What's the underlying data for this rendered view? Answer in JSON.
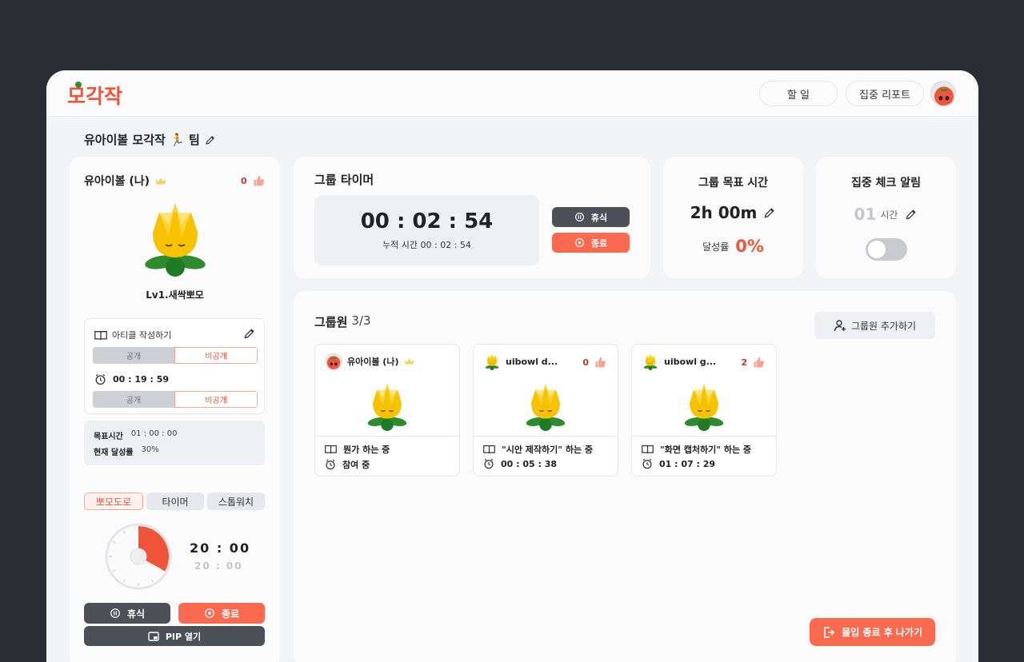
{
  "app": {
    "logo_text": "모각작"
  },
  "header": {
    "todo_label": "할 일",
    "report_label": "집중 리포트"
  },
  "team": {
    "title": "유아이볼 모각작 🏃 팀"
  },
  "profile": {
    "name": "유아이볼 (나)",
    "likes": "0",
    "level": "Lv1.새싹뽀모",
    "article_label": "아티클 작성하기",
    "toggle_public": "공개",
    "toggle_private": "비공개",
    "elapsed": "00 : 19 : 59",
    "goal_time_label": "목표시간",
    "goal_time_value": "01 : 00 : 00",
    "progress_label": "현재 달성률",
    "progress_value": "30%"
  },
  "pomodoro": {
    "tabs": [
      "뽀모도로",
      "타이머",
      "스톱워치"
    ],
    "active_tab": 0,
    "time_main": "20 : 00",
    "time_sub": "20 : 00",
    "dial_fraction": 0.33,
    "pause_label": "휴식",
    "stop_label": "종료",
    "pip_label": "PIP 열기"
  },
  "group_timer": {
    "title": "그룹 타이머",
    "time": "00 : 02 : 54",
    "cumulative_label": "누적 시간 00 : 02 : 54",
    "pause_label": "휴식",
    "stop_label": "종료"
  },
  "group_goal": {
    "title": "그룹 목표 시간",
    "value": "2h 00m",
    "rate_label": "달성률",
    "rate_value": "0%"
  },
  "focus_alert": {
    "title": "집중 체크 알림",
    "hours": "01",
    "unit": "시간",
    "enabled": false
  },
  "members": {
    "title": "그룹원",
    "count": "3/3",
    "add_label": "그룹원 추가하기",
    "list": [
      {
        "name": "유아이볼 (나)",
        "likes": "",
        "status": "뭔가 하는 중",
        "time": "참여 중",
        "avatar": "tomato"
      },
      {
        "name": "uibowl d...",
        "likes": "0",
        "status": "\"시안 제작하기\" 하는 중",
        "time": "00 : 05 : 38",
        "avatar": "flower"
      },
      {
        "name": "uibowl g...",
        "likes": "2",
        "status": "\"화면 캡처하기\" 하는 중",
        "time": "01 : 07 : 29",
        "avatar": "flower"
      }
    ]
  },
  "exit": {
    "label": "몰입 종료 후 나가기"
  },
  "colors": {
    "accent": "#fa6a50",
    "dark": "#4e5058",
    "crown": "#f6d55c"
  }
}
